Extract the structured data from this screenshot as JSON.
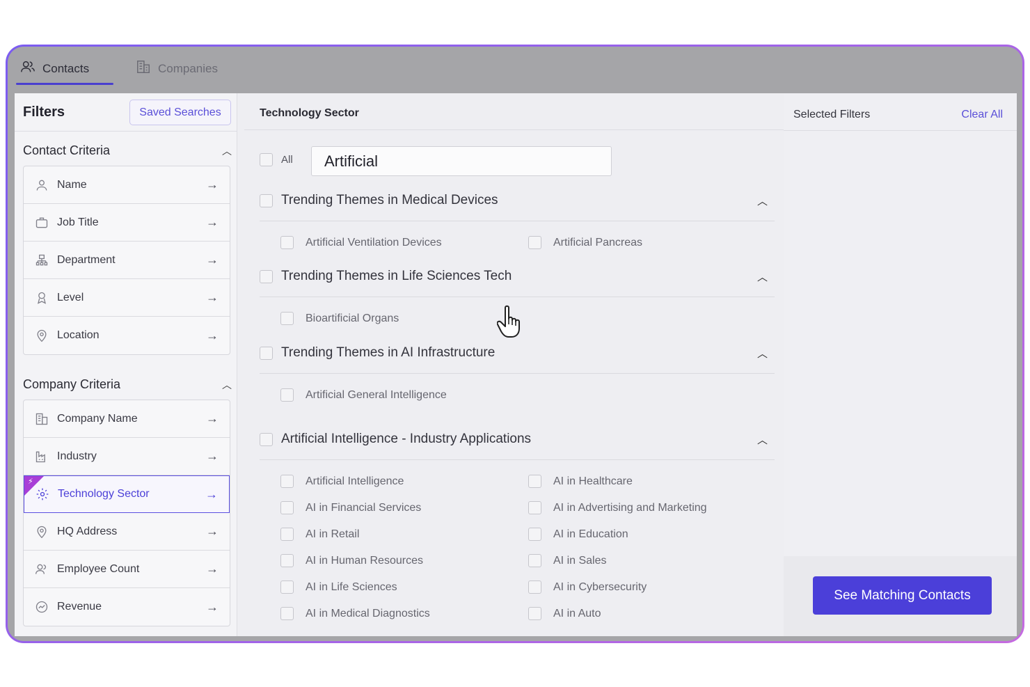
{
  "tabs": [
    {
      "label": "Contacts",
      "icon": "contacts-icon",
      "active": true
    },
    {
      "label": "Companies",
      "icon": "building-icon",
      "active": false
    }
  ],
  "left_panel": {
    "title": "Filters",
    "saved_searches": "Saved Searches",
    "contact_criteria": {
      "title": "Contact Criteria",
      "items": [
        {
          "label": "Name",
          "icon": "user-icon"
        },
        {
          "label": "Job Title",
          "icon": "briefcase-icon"
        },
        {
          "label": "Department",
          "icon": "department-icon"
        },
        {
          "label": "Level",
          "icon": "level-icon"
        },
        {
          "label": "Location",
          "icon": "location-pin-icon"
        }
      ]
    },
    "company_criteria": {
      "title": "Company Criteria",
      "items": [
        {
          "label": "Company Name",
          "icon": "building-icon"
        },
        {
          "label": "Industry",
          "icon": "factory-icon"
        },
        {
          "label": "Technology Sector",
          "icon": "gear-icon",
          "active": true
        },
        {
          "label": "HQ Address",
          "icon": "location-pin-icon"
        },
        {
          "label": "Employee Count",
          "icon": "users-icon"
        },
        {
          "label": "Revenue",
          "icon": "revenue-icon"
        }
      ]
    }
  },
  "center_panel": {
    "title": "Technology Sector",
    "all_label": "All",
    "search_value": "Artificial",
    "groups": [
      {
        "label": "Trending Themes in Medical Devices",
        "options": [
          "Artificial Ventilation Devices",
          "Artificial Pancreas"
        ]
      },
      {
        "label": "Trending Themes in Life Sciences Tech",
        "options": [
          "Bioartificial Organs"
        ]
      },
      {
        "label": "Trending Themes in AI Infrastructure",
        "options": [
          "Artificial General Intelligence"
        ]
      },
      {
        "label": "Artificial Intelligence - Industry Applications",
        "options": [
          "Artificial Intelligence",
          "AI in Healthcare",
          "AI in Financial Services",
          "AI in Advertising and Marketing",
          "AI in Retail",
          "AI in Education",
          "AI in Human Resources",
          "AI in Sales",
          "AI in Life Sciences",
          "AI in Cybersecurity",
          "AI in Medical Diagnostics",
          "AI in Auto"
        ]
      }
    ]
  },
  "right_panel": {
    "title": "Selected Filters",
    "clear_all": "Clear All",
    "cta": "See Matching Contacts"
  },
  "colors": {
    "accent": "#4b3fd9",
    "frame_gradient_start": "#7b5cf0",
    "frame_gradient_end": "#c56ae0",
    "flag": "#a83fd6"
  }
}
